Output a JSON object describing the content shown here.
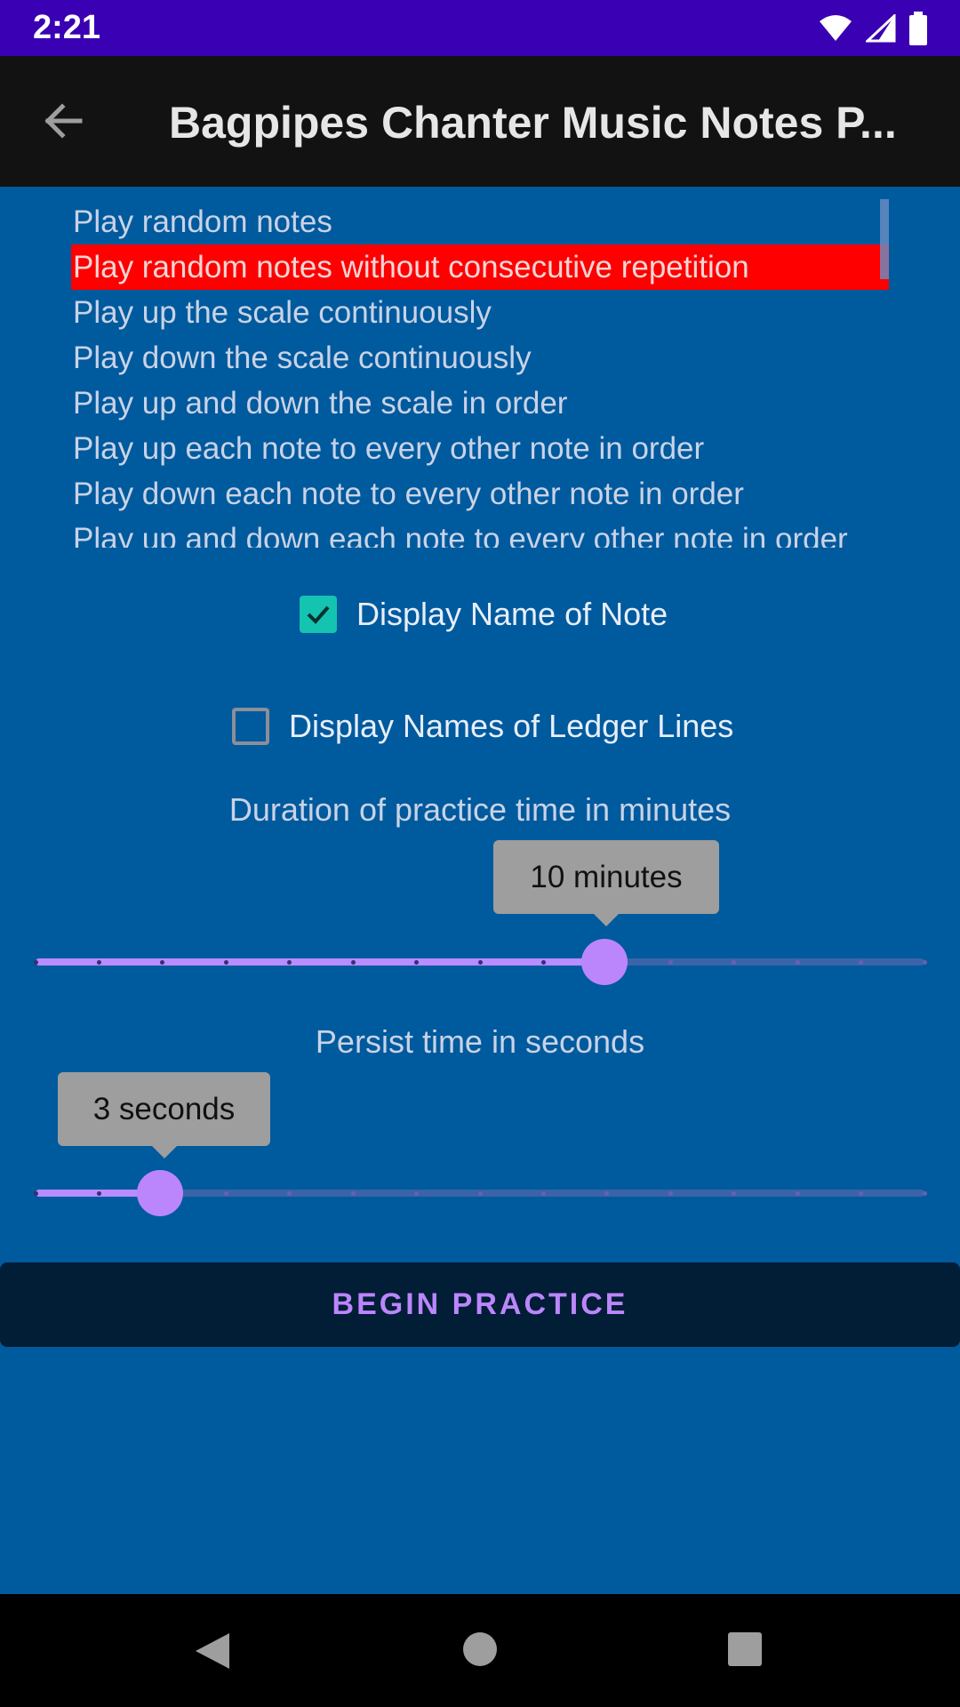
{
  "status_bar": {
    "time": "2:21"
  },
  "app_bar": {
    "title": "Bagpipes Chanter Music Notes P..."
  },
  "mode_list": {
    "items": [
      {
        "label": "Play random notes",
        "selected": false
      },
      {
        "label": "Play random notes without consecutive repetition",
        "selected": true
      },
      {
        "label": "Play up the scale continuously",
        "selected": false
      },
      {
        "label": "Play down the scale continuously",
        "selected": false
      },
      {
        "label": "Play up and down the scale in order",
        "selected": false
      },
      {
        "label": "Play up each note to every other note in order",
        "selected": false
      },
      {
        "label": "Play down each note to every other note in order",
        "selected": false
      },
      {
        "label": "Play up and down each note to every other note in order",
        "selected": false
      }
    ]
  },
  "options": {
    "display_note_name": {
      "label": "Display Name of Note",
      "checked": true
    },
    "display_ledger_names": {
      "label": "Display Names of Ledger Lines",
      "checked": false
    }
  },
  "duration": {
    "label": "Duration of practice time in minutes",
    "value_label": "10 minutes",
    "value_fraction": 0.64,
    "steps": 14
  },
  "persist": {
    "label": "Persist time in seconds",
    "value_label": "3 seconds",
    "value_fraction": 0.14,
    "steps": 14
  },
  "begin_button": {
    "label": "BEGIN PRACTICE"
  },
  "colors": {
    "background": "#005a9e",
    "status_bar": "#3a00b3",
    "app_bar": "#121212",
    "selected_item": "#ff0000",
    "accent": "#bb86fc",
    "checkbox_checked": "#14c3b0",
    "button_bg": "#021d36"
  }
}
